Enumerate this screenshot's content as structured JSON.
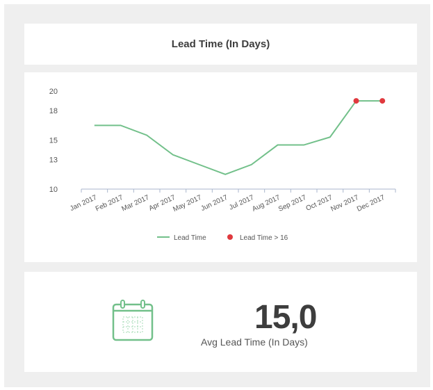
{
  "header": {
    "title": "Lead Time (In Days)"
  },
  "chart_data": {
    "type": "line",
    "categories": [
      "Jan 2017",
      "Feb 2017",
      "Mar 2017",
      "Apr 2017",
      "May 2017",
      "Jun 2017",
      "Jul 2017",
      "Aug 2017",
      "Sep 2017",
      "Oct 2017",
      "Nov 2017",
      "Dec 2017"
    ],
    "series": [
      {
        "name": "Lead Time",
        "values": [
          16.5,
          16.5,
          15.5,
          13.5,
          12.5,
          11.5,
          12.5,
          14.5,
          14.5,
          15.3,
          19.0,
          19.0
        ],
        "color": "#72c08a"
      },
      {
        "name": "Lead Time > 16",
        "values": [
          null,
          null,
          null,
          null,
          null,
          null,
          null,
          null,
          null,
          null,
          19.0,
          19.0
        ],
        "color": "#e0393e"
      }
    ],
    "yticks": [
      10,
      13,
      15,
      18,
      20
    ],
    "ylim": [
      10,
      20
    ],
    "legend_position": "bottom-center",
    "grid": false
  },
  "kpi": {
    "value": "15,0",
    "label": "Avg Lead Time (In Days)"
  }
}
